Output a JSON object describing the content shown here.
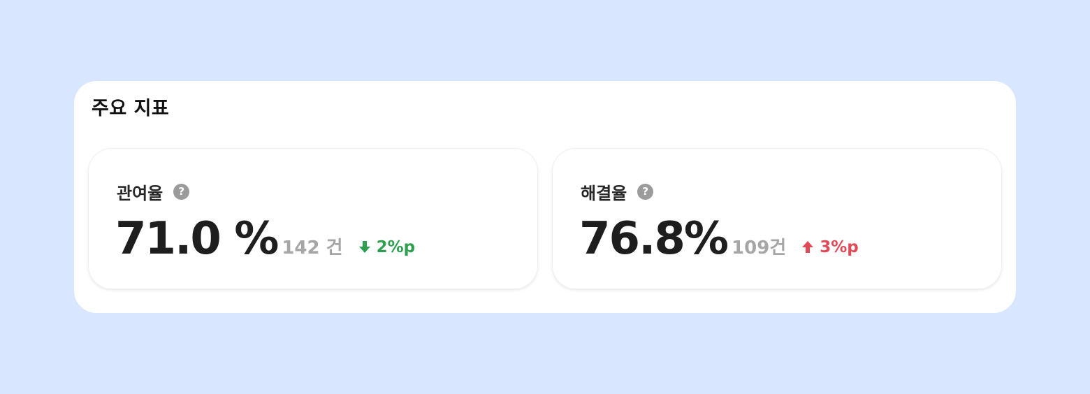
{
  "panel": {
    "title": "주요 지표"
  },
  "metrics": [
    {
      "label": "관여율",
      "help_icon": "question-circle-icon",
      "value": "71.0 %",
      "count": "142 건",
      "delta": "2%p",
      "delta_direction": "down",
      "delta_color": "#2f9e4f"
    },
    {
      "label": "해결율",
      "help_icon": "question-circle-icon",
      "value": "76.8%",
      "count": "109건",
      "delta": "3%p",
      "delta_direction": "up",
      "delta_color": "#e04a57"
    }
  ],
  "help_glyph": "?",
  "colors": {
    "background": "#d8e6ff",
    "panel": "#ffffff",
    "positive": "#2f9e4f",
    "negative": "#e04a57",
    "muted": "#a6a6a6"
  }
}
